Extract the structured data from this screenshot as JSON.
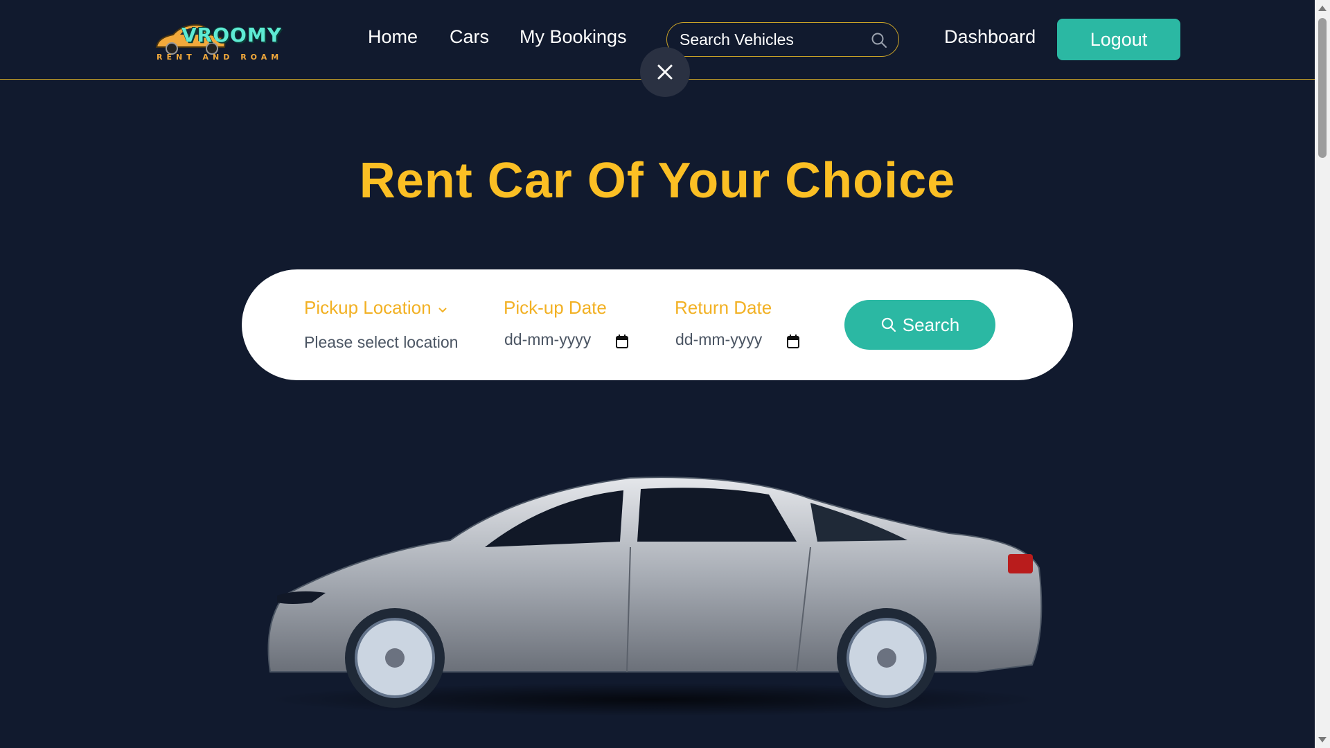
{
  "brand": {
    "name": "VROOMY",
    "tagline": "RENT AND ROAM"
  },
  "nav": {
    "links": [
      {
        "label": "Home"
      },
      {
        "label": "Cars"
      },
      {
        "label": "My Bookings"
      }
    ],
    "search": {
      "placeholder": "Search Vehicles",
      "value": ""
    },
    "dashboard_label": "Dashboard",
    "logout_label": "Logout"
  },
  "hero": {
    "title": "Rent Car Of Your Choice"
  },
  "booking": {
    "pickup_location": {
      "label": "Pickup Location",
      "value": "Please select location"
    },
    "pickup_date": {
      "label": "Pick-up Date",
      "value": "dd-mm-yyyy"
    },
    "return_date": {
      "label": "Return Date",
      "value": "dd-mm-yyyy"
    },
    "search_label": "Search"
  },
  "colors": {
    "background": "#111a2e",
    "accent_gold": "#fbbf24",
    "accent_teal": "#2bb8a3"
  },
  "icons": [
    "search-icon",
    "close-icon",
    "chevron-down-icon",
    "calendar-icon"
  ]
}
